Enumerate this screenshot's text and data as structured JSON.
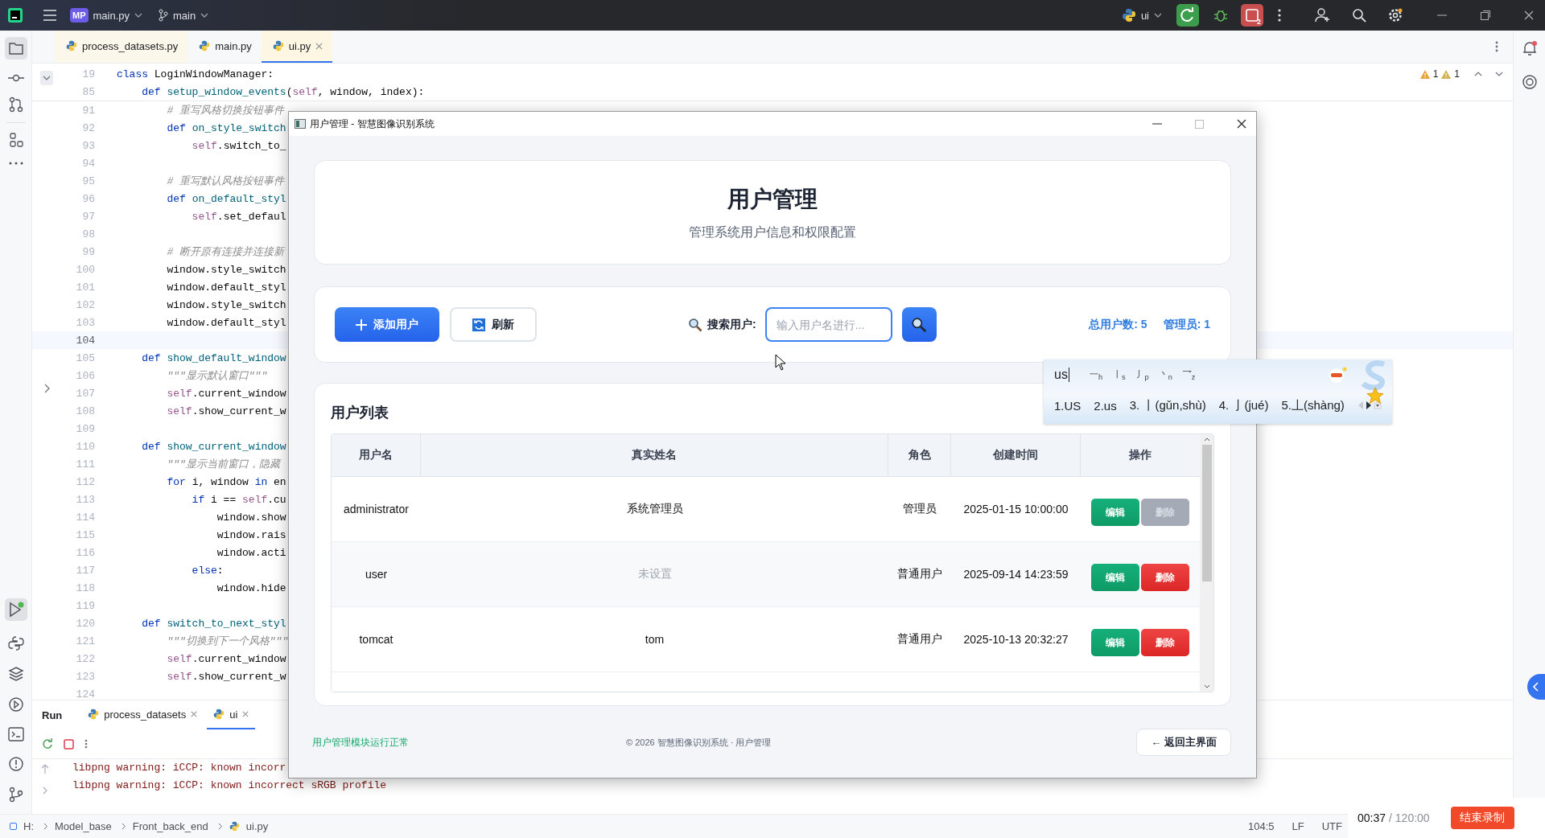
{
  "ide": {
    "title_bar": {
      "project_badge": "MP",
      "project": "main.py",
      "branch": "main",
      "run_config": "ui",
      "badge_count": "2"
    },
    "editor_tabs": [
      {
        "label": "process_datasets.py",
        "selected": false
      },
      {
        "label": "main.py",
        "selected": false
      },
      {
        "label": "ui.py",
        "selected": true
      }
    ],
    "inspections": {
      "warnings": "1",
      "weak_warnings": "1"
    },
    "code_lines": [
      {
        "num": "19",
        "current": false,
        "tokens": [
          {
            "kind": "kw",
            "text": "class"
          },
          {
            "kind": "plain",
            "text": " LoginWindowManager:"
          }
        ]
      },
      {
        "num": "85",
        "current": false,
        "tokens": [
          {
            "kind": "kw",
            "text": "    def"
          },
          {
            "kind": "fn",
            "text": " setup_window_events"
          },
          {
            "kind": "plain",
            "text": "("
          },
          {
            "kind": "self",
            "text": "self"
          },
          {
            "kind": "plain",
            "text": ", window, index):"
          }
        ]
      },
      {
        "num": "91",
        "current": false,
        "tokens": [
          {
            "kind": "comment",
            "text": "        # 重写风格切换按钮事件"
          }
        ]
      },
      {
        "num": "92",
        "current": false,
        "tokens": [
          {
            "kind": "kw",
            "text": "        def"
          },
          {
            "kind": "fn",
            "text": " on_style_switch"
          }
        ]
      },
      {
        "num": "93",
        "current": false,
        "tokens": [
          {
            "kind": "self",
            "text": "            self"
          },
          {
            "kind": "plain",
            "text": ".switch_to_"
          }
        ]
      },
      {
        "num": "94",
        "current": false
      },
      {
        "num": "95",
        "current": false,
        "tokens": [
          {
            "kind": "comment",
            "text": "        # 重写默认风格按钮事件"
          }
        ]
      },
      {
        "num": "96",
        "current": false,
        "tokens": [
          {
            "kind": "kw",
            "text": "        def"
          },
          {
            "kind": "fn",
            "text": " on_default_styl"
          }
        ]
      },
      {
        "num": "97",
        "current": false,
        "tokens": [
          {
            "kind": "self",
            "text": "            self"
          },
          {
            "kind": "plain",
            "text": ".set_defaul"
          }
        ]
      },
      {
        "num": "98",
        "current": false
      },
      {
        "num": "99",
        "current": false,
        "tokens": [
          {
            "kind": "comment",
            "text": "        # 断开原有连接并连接新"
          }
        ]
      },
      {
        "num": "100",
        "current": false,
        "tokens": [
          {
            "kind": "plain",
            "text": "        window.style_switch"
          }
        ]
      },
      {
        "num": "101",
        "current": false,
        "tokens": [
          {
            "kind": "plain",
            "text": "        window.default_styl"
          }
        ]
      },
      {
        "num": "102",
        "current": false,
        "tokens": [
          {
            "kind": "plain",
            "text": "        window.style_switch"
          }
        ]
      },
      {
        "num": "103",
        "current": false,
        "tokens": [
          {
            "kind": "plain",
            "text": "        window.default_styl"
          }
        ]
      },
      {
        "num": "104",
        "current": true
      },
      {
        "num": "105",
        "current": false,
        "tokens": [
          {
            "kind": "kw",
            "text": "    def"
          },
          {
            "kind": "fn",
            "text": " show_default_window"
          }
        ]
      },
      {
        "num": "106",
        "current": false,
        "tokens": [
          {
            "kind": "doc",
            "text": "        \"\"\"显示默认窗口\"\"\""
          }
        ]
      },
      {
        "num": "107",
        "current": false,
        "tokens": [
          {
            "kind": "self",
            "text": "        self"
          },
          {
            "kind": "plain",
            "text": ".current_window"
          }
        ]
      },
      {
        "num": "108",
        "current": false,
        "tokens": [
          {
            "kind": "self",
            "text": "        self"
          },
          {
            "kind": "plain",
            "text": ".show_current_w"
          }
        ]
      },
      {
        "num": "109",
        "current": false
      },
      {
        "num": "110",
        "current": false,
        "tokens": [
          {
            "kind": "kw",
            "text": "    def"
          },
          {
            "kind": "fn",
            "text": " show_current_window"
          }
        ]
      },
      {
        "num": "111",
        "current": false,
        "tokens": [
          {
            "kind": "doc",
            "text": "        \"\"\"显示当前窗口，隐藏"
          }
        ]
      },
      {
        "num": "112",
        "current": false,
        "tokens": [
          {
            "kind": "kw",
            "text": "        for"
          },
          {
            "kind": "plain",
            "text": " i, window "
          },
          {
            "kind": "kw",
            "text": "in"
          },
          {
            "kind": "plain",
            "text": " en"
          }
        ]
      },
      {
        "num": "113",
        "current": false,
        "tokens": [
          {
            "kind": "kw",
            "text": "            if"
          },
          {
            "kind": "plain",
            "text": " i == "
          },
          {
            "kind": "self",
            "text": "self"
          },
          {
            "kind": "plain",
            "text": ".cu"
          }
        ]
      },
      {
        "num": "114",
        "current": false,
        "tokens": [
          {
            "kind": "plain",
            "text": "                window.show"
          }
        ]
      },
      {
        "num": "115",
        "current": false,
        "tokens": [
          {
            "kind": "plain",
            "text": "                window.rais"
          }
        ]
      },
      {
        "num": "116",
        "current": false,
        "tokens": [
          {
            "kind": "plain",
            "text": "                window.acti"
          }
        ]
      },
      {
        "num": "117",
        "current": false,
        "tokens": [
          {
            "kind": "kw",
            "text": "            else"
          },
          {
            "kind": "plain",
            "text": ":"
          }
        ]
      },
      {
        "num": "118",
        "current": false,
        "tokens": [
          {
            "kind": "plain",
            "text": "                window.hide"
          }
        ]
      },
      {
        "num": "119",
        "current": false
      },
      {
        "num": "120",
        "current": false,
        "tokens": [
          {
            "kind": "kw",
            "text": "    def"
          },
          {
            "kind": "fn",
            "text": " switch_to_next_styl"
          }
        ]
      },
      {
        "num": "121",
        "current": false,
        "tokens": [
          {
            "kind": "doc",
            "text": "        \"\"\"切换到下一个风格\"\"\""
          }
        ]
      },
      {
        "num": "122",
        "current": false,
        "tokens": [
          {
            "kind": "self",
            "text": "        self"
          },
          {
            "kind": "plain",
            "text": ".current_window"
          }
        ]
      },
      {
        "num": "123",
        "current": false,
        "tokens": [
          {
            "kind": "self",
            "text": "        self"
          },
          {
            "kind": "plain",
            "text": ".show_current_w"
          }
        ]
      },
      {
        "num": "124",
        "current": false
      }
    ],
    "run_panel": {
      "title": "Run",
      "tabs": [
        {
          "label": "process_datasets",
          "selected": false
        },
        {
          "label": "ui",
          "selected": true
        }
      ],
      "output": [
        "libpng warning: iCCP: known incorr",
        "libpng warning: iCCP: known incorrect sRGB profile"
      ]
    },
    "status_bar": {
      "breadcrumbs": [
        "H:",
        "Model_base",
        "Front_back_end",
        "ui.py"
      ],
      "position": "104:5",
      "line_separator": "LF",
      "encoding": "UTF"
    }
  },
  "dialog": {
    "title": "用户管理 - 智慧图像识别系统",
    "header": {
      "title": "用户管理",
      "subtitle": "管理系统用户信息和权限配置"
    },
    "toolbar": {
      "add_button": "添加用户",
      "refresh_button": "刷新",
      "search_label": "搜索用户:",
      "search": {
        "placeholder": "输入用户名进行..."
      },
      "stats": [
        "总用户数: 5",
        "管理员: 1"
      ]
    },
    "user_list": {
      "title": "用户列表",
      "columns": [
        "用户名",
        "真实姓名",
        "角色",
        "创建时间",
        "操作"
      ],
      "rows": [
        {
          "username": "administrator",
          "real_name": "系统管理员",
          "real_name_unset": false,
          "role": "管理员",
          "created": "2025-01-15 10:00:00",
          "actions": [
            {
              "kind": "edit",
              "label": "编辑",
              "disabled": false
            },
            {
              "kind": "delete",
              "label": "删除",
              "disabled": true
            }
          ]
        },
        {
          "username": "user",
          "real_name": "未设置",
          "real_name_unset": true,
          "role": "普通用户",
          "created": "2025-09-14 14:23:59",
          "actions": [
            {
              "kind": "edit",
              "label": "编辑",
              "disabled": false
            },
            {
              "kind": "delete",
              "label": "删除",
              "disabled": false
            }
          ]
        },
        {
          "username": "tomcat",
          "real_name": "tom",
          "real_name_unset": false,
          "role": "普通用户",
          "created": "2025-10-13 20:32:27",
          "actions": [
            {
              "kind": "edit",
              "label": "编辑",
              "disabled": false
            },
            {
              "kind": "delete",
              "label": "删除",
              "disabled": false
            }
          ]
        }
      ]
    },
    "footer": {
      "status": "用户管理模块运行正常",
      "copyright": "© 2026 智慧图像识别系统 · 用户管理",
      "back_button": "← 返回主界面"
    }
  },
  "ime": {
    "composition": "us",
    "strokes": [
      "一$_{h}$",
      "丨$_{s}$",
      "丿$_{p}$",
      "丶$_{n}$",
      "乛$_{z}$"
    ],
    "candidates": [
      "1.US",
      "2.us",
      "3. 丨(gǔn,shù)",
      "4. 亅(jué)",
      "5.丄(shàng)"
    ]
  },
  "recording": {
    "elapsed": "00:37",
    "limit": "/ 120:00",
    "stop_button": "结束录制"
  }
}
